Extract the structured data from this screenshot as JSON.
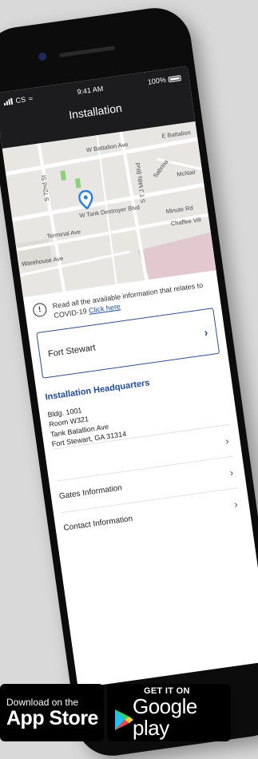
{
  "status_bar": {
    "carrier": "CS",
    "time": "9:41 AM",
    "battery": "100%"
  },
  "nav": {
    "title": "Installation"
  },
  "map": {
    "streets": [
      "W Battalion Ave",
      "E Battalion",
      "S 72nd St",
      "S T J Mills Blvd",
      "Sabrina",
      "McNair",
      "W Tank Destroyer Blvd",
      "Terminal Ave",
      "Minute Rd",
      "Chaffee Vill",
      "Warehouse Ave"
    ]
  },
  "covid": {
    "notice": "Read all the available information that relates to COVID-19",
    "link": "Click here"
  },
  "installation": {
    "selected": "Fort Stewart"
  },
  "headquarters": {
    "heading": "Installation Headquarters",
    "lines": [
      "Bldg. 1001",
      "Room W321",
      "Tank Batallion Ave",
      "Fort Stewart, GA 31314"
    ]
  },
  "list": [
    {
      "label": ""
    },
    {
      "label": "Gates Information"
    },
    {
      "label": "Contact Information"
    }
  ],
  "badges": {
    "appstore_small": "Download on the",
    "appstore_big": "App Store",
    "google_small": "GET IT ON",
    "google_big": "Google play"
  },
  "colors": {
    "accent": "#1f4a96",
    "link": "#1a4fa6",
    "topbar": "#1c1c1e",
    "map_bg": "#e8e6e2"
  },
  "icons": [
    "signal-icon",
    "wifi-icon",
    "battery-icon",
    "map-pin-icon",
    "alert-icon",
    "chevron-right-icon",
    "apple-icon",
    "google-play-icon"
  ]
}
